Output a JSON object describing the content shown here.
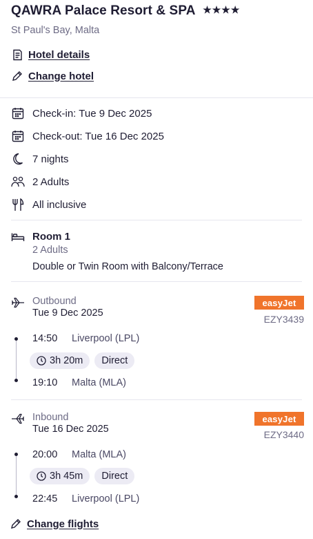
{
  "hotel": {
    "name": "QAWRA Palace Resort & SPA",
    "stars": "★★★★",
    "location": "St Paul's Bay, Malta",
    "details_link": "Hotel details",
    "change_link": "Change hotel"
  },
  "stay": {
    "checkin": "Check-in: Tue 9 Dec 2025",
    "checkout": "Check-out: Tue 16 Dec 2025",
    "nights": "7 nights",
    "guests": "2 Adults",
    "board": "All inclusive"
  },
  "room": {
    "title": "Room 1",
    "guests": "2 Adults",
    "type": "Double or Twin Room with Balcony/Terrace"
  },
  "outbound": {
    "label": "Outbound",
    "date": "Tue 9 Dec 2025",
    "airline": "easyJet",
    "flight_no": "EZY3439",
    "depart_time": "14:50",
    "depart_place": "Liverpool (LPL)",
    "duration": "3h 20m",
    "stops": "Direct",
    "arrive_time": "19:10",
    "arrive_place": "Malta (MLA)"
  },
  "inbound": {
    "label": "Inbound",
    "date": "Tue 16 Dec 2025",
    "airline": "easyJet",
    "flight_no": "EZY3440",
    "depart_time": "20:00",
    "depart_place": "Malta (MLA)",
    "duration": "3h 45m",
    "stops": "Direct",
    "arrive_time": "22:45",
    "arrive_place": "Liverpool (LPL)"
  },
  "flights": {
    "change_link": "Change flights"
  },
  "colors": {
    "airline_badge": "#f0742b",
    "pill_bg": "#ecebf4",
    "text": "#1f1d33",
    "muted": "#6d6b85"
  }
}
